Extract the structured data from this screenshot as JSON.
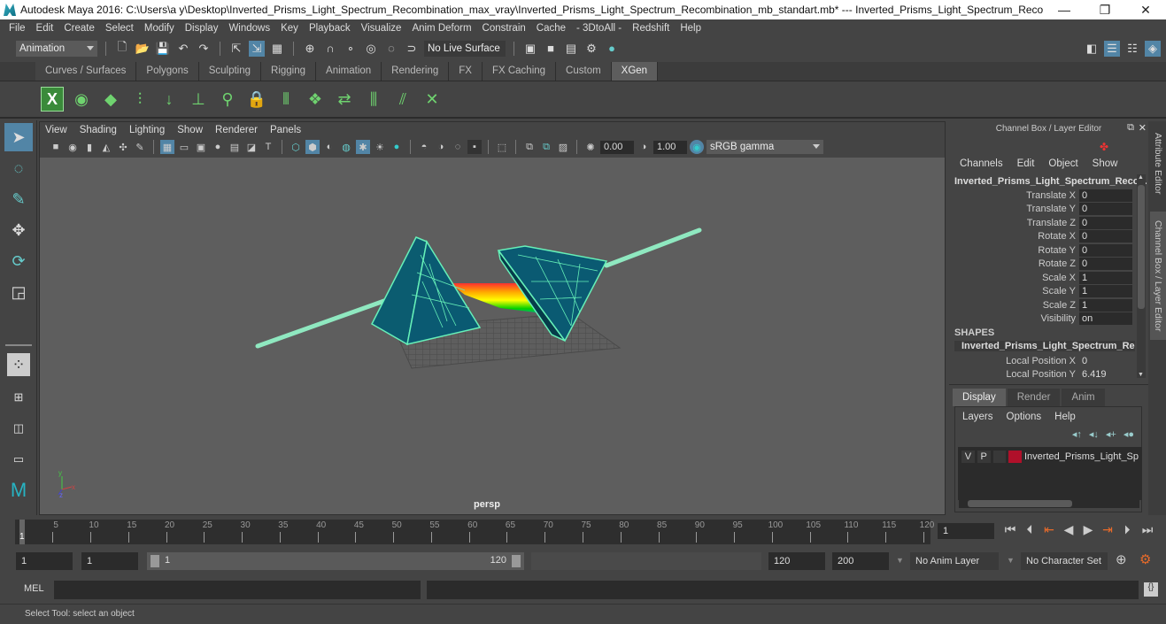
{
  "window": {
    "title": "Autodesk Maya 2016: C:\\Users\\a y\\Desktop\\Inverted_Prisms_Light_Spectrum_Recombination_max_vray\\Inverted_Prisms_Light_Spectrum_Recombination_mb_standart.mb*  ---  Inverted_Prisms_Light_Spectrum_Recombinatio...",
    "minimize": "—",
    "restore": "❐",
    "close": "✕"
  },
  "menubar": [
    "File",
    "Edit",
    "Create",
    "Select",
    "Modify",
    "Display",
    "Windows",
    "Key",
    "Playback",
    "Visualize",
    "Anim Deform",
    "Constrain",
    "Cache",
    "- 3DtoAll -",
    "Redshift",
    "Help"
  ],
  "statusline": {
    "menuset": "Animation",
    "live_surface": "No Live Surface"
  },
  "shelf_tabs": [
    {
      "label": "Curves / Surfaces",
      "active": false
    },
    {
      "label": "Polygons",
      "active": false
    },
    {
      "label": "Sculpting",
      "active": false
    },
    {
      "label": "Rigging",
      "active": false
    },
    {
      "label": "Animation",
      "active": false
    },
    {
      "label": "Rendering",
      "active": false
    },
    {
      "label": "FX",
      "active": false
    },
    {
      "label": "FX Caching",
      "active": false
    },
    {
      "label": "Custom",
      "active": false
    },
    {
      "label": "XGen",
      "active": true
    }
  ],
  "shelf_icons": [
    "xgen-window-icon",
    "xgen-preview-icon",
    "xgen-clear-icon",
    "add-guides-icon",
    "sculpt-guides-icon",
    "add-guide-icon",
    "guide-select-icon",
    "lock-guides-icon",
    "rebuild-guides-icon",
    "grooming-icon",
    "bake-guides-icon",
    "select-guides-icon",
    "flip-guides-icon",
    "delete-guides-icon"
  ],
  "toolbox": [
    "select-tool-icon",
    "lasso-tool-icon",
    "paint-select-icon",
    "move-tool-icon",
    "rotate-tool-icon",
    "scale-tool-icon"
  ],
  "viewport": {
    "menu": [
      "View",
      "Shading",
      "Lighting",
      "Show",
      "Renderer",
      "Panels"
    ],
    "exposure": "0.00",
    "gamma": "1.00",
    "color_space": "sRGB gamma",
    "camera_label": "persp",
    "axis": {
      "y": "y",
      "x": "x",
      "z": "z"
    }
  },
  "channel_box": {
    "header": "Channel Box / Layer Editor",
    "menu": [
      "Channels",
      "Edit",
      "Object",
      "Show"
    ],
    "object_name": "Inverted_Prisms_Light_Spectrum_Reco...",
    "channels": [
      {
        "label": "Translate X",
        "value": "0"
      },
      {
        "label": "Translate Y",
        "value": "0"
      },
      {
        "label": "Translate Z",
        "value": "0"
      },
      {
        "label": "Rotate X",
        "value": "0"
      },
      {
        "label": "Rotate Y",
        "value": "0"
      },
      {
        "label": "Rotate Z",
        "value": "0"
      },
      {
        "label": "Scale X",
        "value": "1"
      },
      {
        "label": "Scale Y",
        "value": "1"
      },
      {
        "label": "Scale Z",
        "value": "1"
      },
      {
        "label": "Visibility",
        "value": "on"
      }
    ],
    "shapes_header": "SHAPES",
    "shape_name": "Inverted_Prisms_Light_Spectrum_Re...",
    "shape_channels": [
      {
        "label": "Local Position X",
        "value": "0"
      },
      {
        "label": "Local Position Y",
        "value": "6.419"
      }
    ]
  },
  "side_tabs": [
    "Attribute Editor",
    "Channel Box / Layer Editor"
  ],
  "layer_editor": {
    "tabs": [
      {
        "label": "Display",
        "active": true
      },
      {
        "label": "Render",
        "active": false
      },
      {
        "label": "Anim",
        "active": false
      }
    ],
    "menu": [
      "Layers",
      "Options",
      "Help"
    ],
    "layers": [
      {
        "v": "V",
        "p": "P",
        "color": "#b0102a",
        "name": "Inverted_Prisms_Light_Sp"
      }
    ]
  },
  "timeline": {
    "ticks": [
      1,
      5,
      10,
      15,
      20,
      25,
      30,
      35,
      40,
      45,
      50,
      55,
      60,
      65,
      70,
      75,
      80,
      85,
      90,
      95,
      100,
      105,
      110,
      115,
      120
    ],
    "start": 1,
    "end": 120,
    "current_label": "1",
    "current_frame": "1"
  },
  "range": {
    "start_time": "1",
    "playback_start": "1",
    "slider_start": "1",
    "slider_end": "120",
    "playback_end": "120",
    "end_time": "200",
    "anim_layer": "No Anim Layer",
    "character_set": "No Character Set"
  },
  "command_line": {
    "label": "MEL"
  },
  "help_line": "Select Tool: select an object"
}
